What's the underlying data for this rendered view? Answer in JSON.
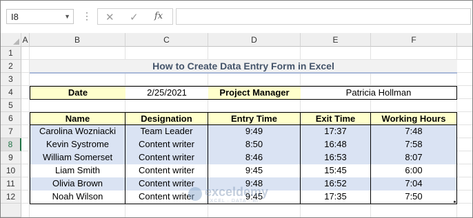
{
  "formula_bar": {
    "name_box": "I8",
    "cancel_icon": "✕",
    "enter_icon": "✓",
    "fx_label": "fx",
    "formula": ""
  },
  "columns": [
    "A",
    "B",
    "C",
    "D",
    "E",
    "F"
  ],
  "rows": [
    "1",
    "2",
    "3",
    "4",
    "5",
    "6",
    "7",
    "8",
    "9",
    "10",
    "11",
    "12"
  ],
  "selected_row": "8",
  "sheet": {
    "title": "How to Create Data Entry Form in Excel",
    "date_label": "Date",
    "date_value": "2/25/2021",
    "pm_label": "Project Manager",
    "pm_value": "Patricia Hollman",
    "table_headers": [
      "Name",
      "Designation",
      "Entry Time",
      "Exit Time",
      "Working Hours"
    ],
    "table_rows": [
      [
        "Carolina Wozniacki",
        "Team Leader",
        "9:49",
        "17:37",
        "7:48"
      ],
      [
        "Kevin Systrome",
        "Content writer",
        "8:50",
        "16:48",
        "7:58"
      ],
      [
        "William Somerset",
        "Content writer",
        "8:46",
        "16:53",
        "8:07"
      ],
      [
        "Liam Smith",
        "Content writer",
        "9:45",
        "15:45",
        "6:00"
      ],
      [
        "Olivia Brown",
        "Content writer",
        "9:48",
        "16:52",
        "7:04"
      ],
      [
        "Noah Wilson",
        "Content writer",
        "9:45",
        "17:35",
        "7:50"
      ]
    ]
  },
  "watermark": {
    "name": "exceldemy",
    "tagline": "EXCEL · DATA · BI"
  },
  "colors": {
    "header_fill": "#ffffcc",
    "band_fill": "#dae3f3",
    "title_color": "#44546a",
    "accent": "#217346"
  }
}
